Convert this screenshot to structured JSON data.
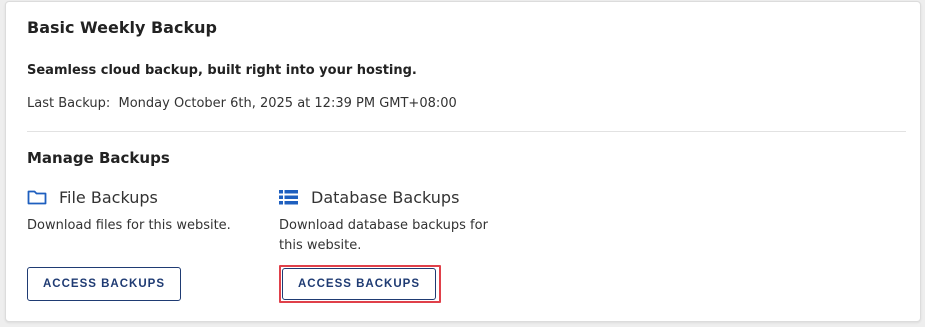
{
  "card": {
    "title": "Basic Weekly Backup",
    "tagline": "Seamless cloud backup, built right into your hosting.",
    "last_backup_label": "Last Backup:",
    "last_backup_value": "Monday October 6th, 2025 at 12:39 PM GMT+08:00"
  },
  "manage": {
    "title": "Manage Backups",
    "file": {
      "icon": "folder-icon",
      "label": "File Backups",
      "description": "Download files for this website.",
      "button_label": "ACCESS BACKUPS"
    },
    "database": {
      "icon": "database-list-icon",
      "label": "Database Backups",
      "description": "Download database backups for this website.",
      "button_label": "ACCESS BACKUPS"
    }
  },
  "colors": {
    "accent": "#1f3b73",
    "icon_blue": "#1e5fbf",
    "highlight": "#e0404a"
  }
}
